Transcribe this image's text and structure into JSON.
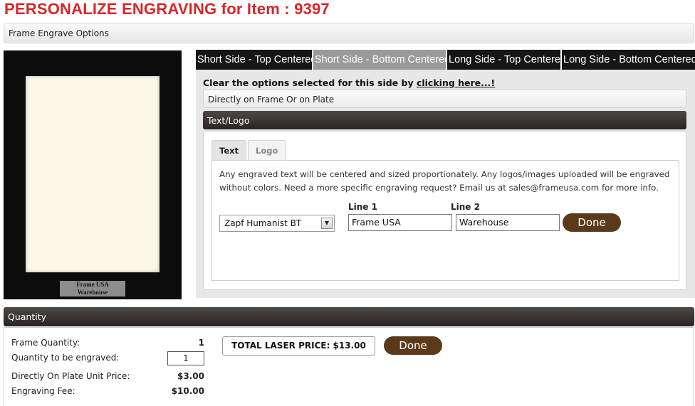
{
  "page": {
    "title": "PERSONALIZE ENGRAVING for Item : 9397"
  },
  "options_bar": {
    "label": "Frame Engrave Options"
  },
  "preview": {
    "plate_line1": "Frame USA",
    "plate_line2": "Warehouse"
  },
  "side_tabs": [
    {
      "label": "Short Side - Top Centered",
      "active": false
    },
    {
      "label": "Short Side - Bottom Centered",
      "active": true
    },
    {
      "label": "Long Side - Top Centered",
      "active": false
    },
    {
      "label": "Long Side - Bottom Centered",
      "active": false
    }
  ],
  "clear": {
    "prefix": "Clear the options selected for this side by ",
    "link": "clicking here...!"
  },
  "direct_bar": {
    "label": "Directly on Frame Or on Plate"
  },
  "textlogo": {
    "header": "Text/Logo",
    "tabs": [
      {
        "label": "Text",
        "active": true
      },
      {
        "label": "Logo",
        "active": false
      }
    ],
    "info": "Any engraved text will be centered and sized proportionately. Any logos/images uploaded will be engraved without colors. Need a more specific engraving request? Email us at sales@frameusa.com for more info.",
    "font_select": "Zapf Humanist BT",
    "line1_label": "Line 1",
    "line1_value": "Frame USA",
    "line2_label": "Line 2",
    "line2_value": "Warehouse",
    "done_label": "Done"
  },
  "quantity": {
    "header": "Quantity",
    "frame_quantity_label": "Frame Quantity:",
    "frame_quantity_value": "1",
    "engrave_quantity_label": "Quantity to be engraved:",
    "engrave_quantity_value": "1",
    "unit_price_label": "Directly On Plate Unit Price:",
    "unit_price_value": "$3.00",
    "fee_label": "Engraving Fee:",
    "fee_value": "$10.00",
    "total_label": "TOTAL LASER PRICE: $13.00",
    "done_label": "Done"
  },
  "colors": {
    "title_red": "#d9262a",
    "button_brown": "#5a3a1a",
    "header_dark": "#2a2423"
  }
}
